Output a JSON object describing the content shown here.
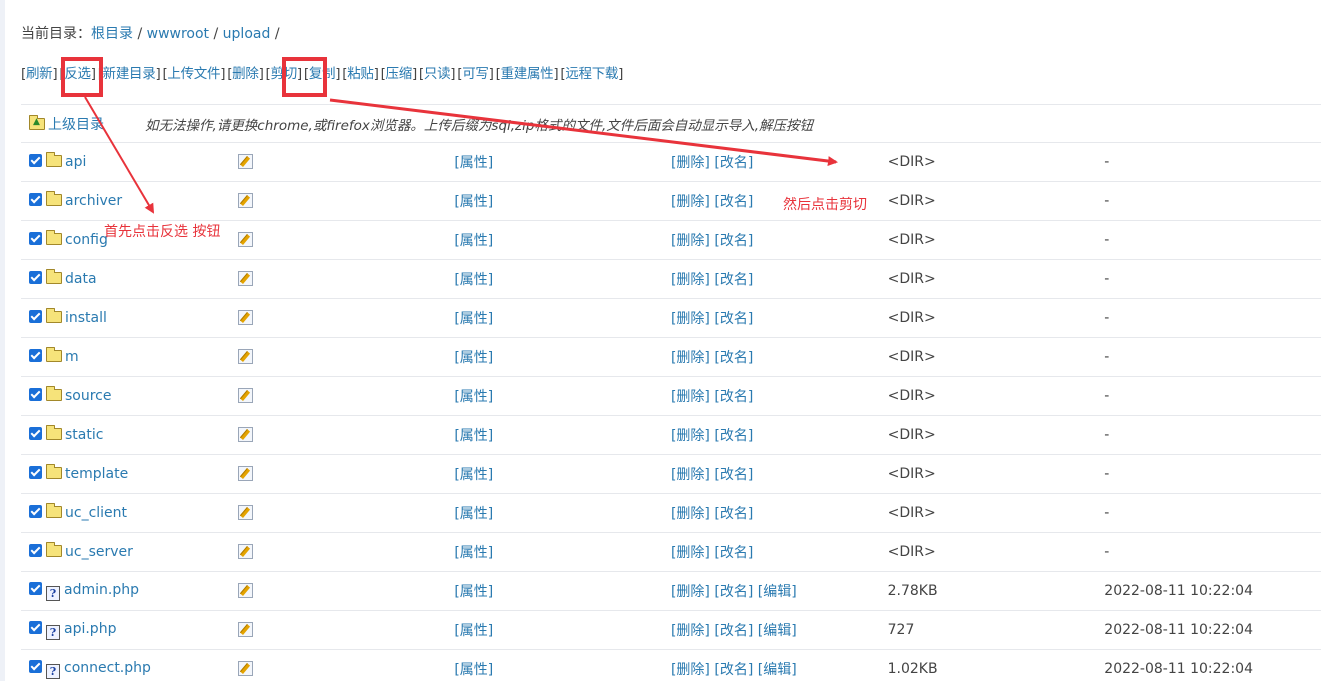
{
  "breadcrumb": {
    "label": "当前目录：",
    "parts": [
      "根目录",
      "wwwroot",
      "upload"
    ],
    "sep": "/"
  },
  "toolbar": [
    "刷新",
    "反选",
    "新建目录",
    "上传文件",
    "删除",
    "剪切",
    "复制",
    "粘贴",
    "压缩",
    "只读",
    "可写",
    "重建属性",
    "远程下载"
  ],
  "parent_row": {
    "label": "上级目录",
    "hint": "如无法操作,请更换chrome,或firefox浏览器。上传后缀为sql,zip格式的文件,文件后面会自动显示导入,解压按钮"
  },
  "row_actions": {
    "attr": "[属性]",
    "delete": "[删除]",
    "rename": "[改名]",
    "edit": "[编辑]"
  },
  "rows": [
    {
      "name": "api",
      "type": "dir",
      "size": "<DIR>",
      "date": "-"
    },
    {
      "name": "archiver",
      "type": "dir",
      "size": "<DIR>",
      "date": "-"
    },
    {
      "name": "config",
      "type": "dir",
      "size": "<DIR>",
      "date": "-"
    },
    {
      "name": "data",
      "type": "dir",
      "size": "<DIR>",
      "date": "-"
    },
    {
      "name": "install",
      "type": "dir",
      "size": "<DIR>",
      "date": "-"
    },
    {
      "name": "m",
      "type": "dir",
      "size": "<DIR>",
      "date": "-"
    },
    {
      "name": "source",
      "type": "dir",
      "size": "<DIR>",
      "date": "-"
    },
    {
      "name": "static",
      "type": "dir",
      "size": "<DIR>",
      "date": "-"
    },
    {
      "name": "template",
      "type": "dir",
      "size": "<DIR>",
      "date": "-"
    },
    {
      "name": "uc_client",
      "type": "dir",
      "size": "<DIR>",
      "date": "-"
    },
    {
      "name": "uc_server",
      "type": "dir",
      "size": "<DIR>",
      "date": "-"
    },
    {
      "name": "admin.php",
      "type": "file",
      "size": "2.78KB",
      "date": "2022-08-11 10:22:04"
    },
    {
      "name": "api.php",
      "type": "file",
      "size": "727",
      "date": "2022-08-11 10:22:04"
    },
    {
      "name": "connect.php",
      "type": "file",
      "size": "1.02KB",
      "date": "2022-08-11 10:22:04"
    }
  ],
  "annotations": {
    "step1": "首先点击反选 按钮",
    "step2": "然后点击剪切",
    "color": "#e8333b"
  },
  "colors": {
    "link": "#2a7ab0",
    "checkbox": "#1a6fd8",
    "row_border": "#e6e8ec"
  }
}
